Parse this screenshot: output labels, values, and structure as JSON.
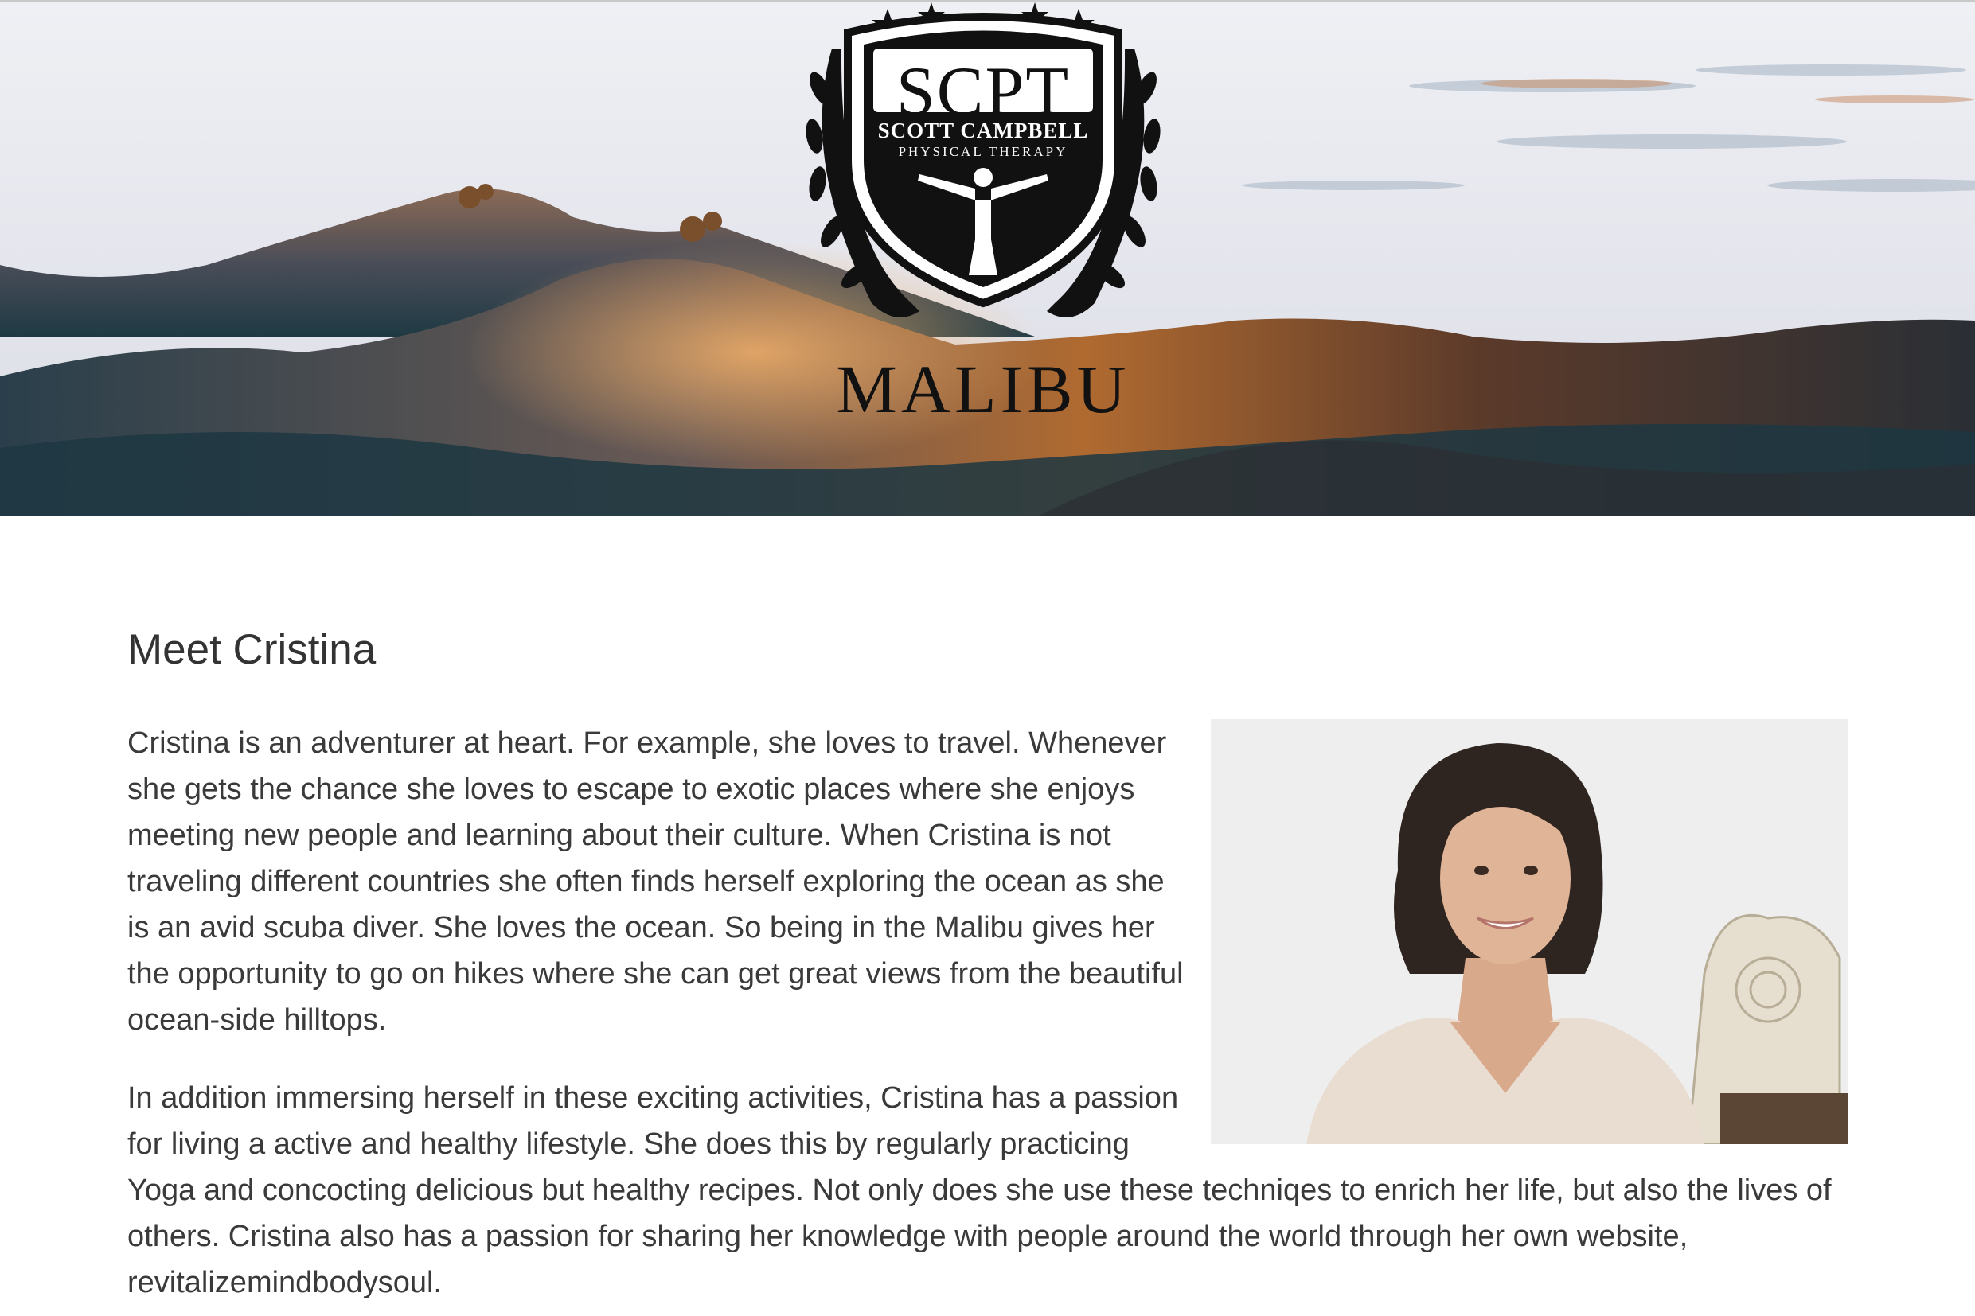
{
  "header": {
    "logo": {
      "initials": "SCPT",
      "name_line": "SCOTT CAMPBELL",
      "subtitle": "PHYSICAL THERAPY",
      "location": "MALIBU"
    }
  },
  "main": {
    "heading": "Meet Cristina",
    "paragraph_1": "Cristina is an adventurer at heart. For example, she loves to travel. Whenever she gets the chance she loves to escape to exotic places where she enjoys meeting new people and learning about their culture. When Cristina is not traveling different countries she often finds herself exploring the ocean as she is an avid scuba diver. She loves the ocean. So being in the Malibu gives her the opportunity to go on hikes where she can get great views from the beautiful ocean-side hilltops.",
    "paragraph_2_lead": "In addition immersing herself in these exciting activities, Cristina has a passion for living a active and healthy lifestyle. She does this by regularly practicing",
    "paragraph_2_rest": "Yoga and concocting delicious but healthy recipes. Not only does she use these techniqes to enrich her life, but also the lives of others. Cristina also has a passion for sharing her knowledge with people around the world through her own website, revitalizemindbodysoul."
  }
}
